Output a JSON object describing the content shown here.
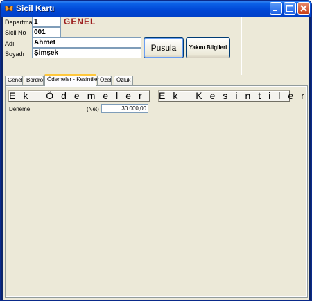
{
  "window": {
    "title": "Sicil Kartı",
    "icons": {
      "app": "butterfly-icon",
      "minimize": "minimize-icon",
      "maximize": "maximize-icon",
      "close": "close-icon"
    }
  },
  "header": {
    "departman_label": "Departman",
    "departman_value": "1",
    "group_name": "GENEL",
    "sicil_label": "Sicil No",
    "sicil_value": "001",
    "adi_label": "Adı",
    "adi_value": "Ahmet",
    "soyadi_label": "Soyadı",
    "soyadi_value": "Şimşek",
    "pusula_button": "Pusula",
    "yakini_button": "Yakını Bilgileri"
  },
  "tabs": [
    {
      "label": "Genel",
      "active": false
    },
    {
      "label": "Bordro",
      "active": false
    },
    {
      "label": "Ödemeler - Kesintiler",
      "active": true
    },
    {
      "label": "Özel",
      "active": false
    },
    {
      "label": "Özlük",
      "active": false
    }
  ],
  "odemeler": {
    "ek_odemeler_title": "Ek Ödemeler",
    "ek_kesintiler_title": "Ek Kesintiler",
    "rows": [
      {
        "name": "Deneme",
        "type": "(Net)",
        "amount": "30.000,00"
      }
    ]
  },
  "colors": {
    "group_name": "#9b1c1c",
    "titlebar": "#0046d5",
    "active_tab_accent": "#ffc83c"
  }
}
